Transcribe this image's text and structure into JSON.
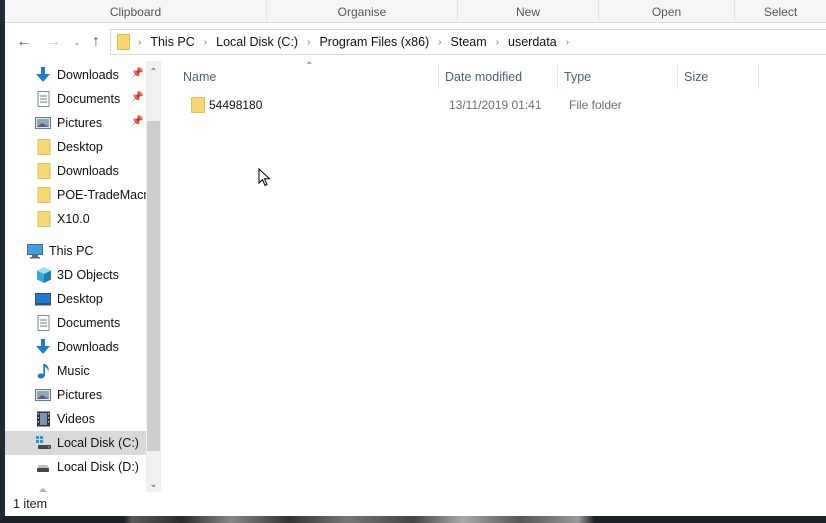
{
  "ribbon": {
    "groups": [
      "Clipboard",
      "Organise",
      "New",
      "Open",
      "Select"
    ]
  },
  "nav": {
    "back_icon": "arrow-left-icon",
    "forward_icon": "arrow-right-icon",
    "recent_icon": "chevron-down-icon",
    "up_icon": "arrow-up-icon",
    "breadcrumb": [
      "This PC",
      "Local Disk (C:)",
      "Program Files (x86)",
      "Steam",
      "userdata"
    ]
  },
  "sidebar": {
    "quick_access": [
      {
        "label": "Downloads",
        "icon": "download-arrow-icon",
        "pinned": true
      },
      {
        "label": "Documents",
        "icon": "document-icon",
        "pinned": true
      },
      {
        "label": "Pictures",
        "icon": "pictures-icon",
        "pinned": true
      },
      {
        "label": "Desktop",
        "icon": "folder-icon",
        "pinned": false
      },
      {
        "label": "Downloads",
        "icon": "folder-icon",
        "pinned": false
      },
      {
        "label": "POE-TradeMacro",
        "icon": "folder-icon",
        "pinned": false
      },
      {
        "label": "X10.0",
        "icon": "folder-icon",
        "pinned": false
      }
    ],
    "this_pc": {
      "label": "This PC",
      "icon": "computer-icon"
    },
    "this_pc_items": [
      {
        "label": "3D Objects",
        "icon": "cube-icon"
      },
      {
        "label": "Desktop",
        "icon": "desktop-icon"
      },
      {
        "label": "Documents",
        "icon": "document-icon"
      },
      {
        "label": "Downloads",
        "icon": "download-arrow-icon"
      },
      {
        "label": "Music",
        "icon": "music-note-icon"
      },
      {
        "label": "Pictures",
        "icon": "pictures-icon"
      },
      {
        "label": "Videos",
        "icon": "film-icon"
      },
      {
        "label": "Local Disk (C:)",
        "icon": "system-drive-icon",
        "selected": true
      },
      {
        "label": "Local Disk (D:)",
        "icon": "drive-icon"
      }
    ]
  },
  "list": {
    "columns": [
      "Name",
      "Date modified",
      "Type",
      "Size"
    ],
    "sort_column": "Name",
    "rows": [
      {
        "name": "54498180",
        "date_modified": "13/11/2019 01:41",
        "type": "File folder",
        "size": ""
      }
    ]
  },
  "status": {
    "item_count": "1 item"
  },
  "colors": {
    "folder": "#f8d775",
    "selected_bg": "#d9d9d9",
    "header_text": "#4c607a",
    "accent_blue": "#1e7ad7"
  }
}
